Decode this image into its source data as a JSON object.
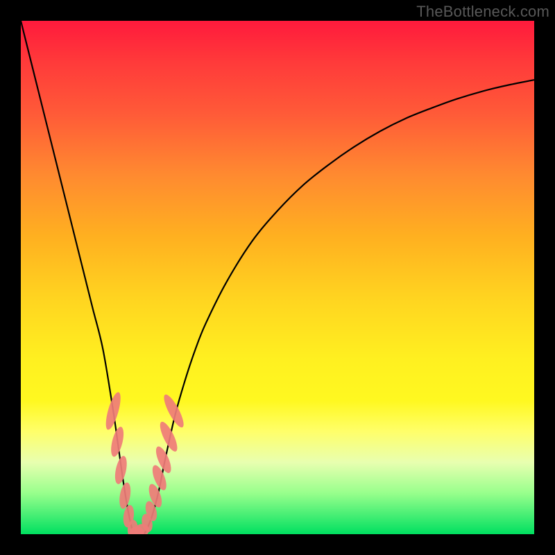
{
  "watermark": "TheBottleneck.com",
  "colors": {
    "frame": "#000000",
    "curve": "#000000",
    "marker_fill": "#ef7c78",
    "marker_stroke": "#ef7c78"
  },
  "chart_data": {
    "type": "line",
    "title": "",
    "xlabel": "",
    "ylabel": "",
    "xlim": [
      0,
      100
    ],
    "ylim": [
      0,
      100
    ],
    "grid": false,
    "series": [
      {
        "name": "bottleneck-curve",
        "x": [
          0,
          2,
          4,
          6,
          8,
          10,
          12,
          14,
          16,
          18,
          19,
          20,
          21,
          22,
          23,
          24,
          25,
          26,
          27,
          28,
          30,
          32,
          34,
          36,
          40,
          45,
          50,
          55,
          60,
          65,
          70,
          75,
          80,
          85,
          90,
          95,
          100
        ],
        "y": [
          100,
          92,
          84,
          76,
          68,
          60,
          52,
          44,
          36,
          24,
          17,
          10,
          4,
          0,
          0,
          0,
          2,
          5,
          9,
          14,
          23,
          30,
          36,
          41,
          49,
          57,
          63,
          68,
          72,
          75.5,
          78.5,
          81,
          83,
          84.8,
          86.3,
          87.5,
          88.5
        ]
      }
    ],
    "markers": [
      {
        "x": 18.0,
        "y": 24,
        "rx": 1.0,
        "ry": 3.8,
        "rot": 16
      },
      {
        "x": 18.8,
        "y": 18,
        "rx": 1.0,
        "ry": 3.0,
        "rot": 14
      },
      {
        "x": 19.5,
        "y": 12.5,
        "rx": 1.0,
        "ry": 2.8,
        "rot": 12
      },
      {
        "x": 20.3,
        "y": 7.5,
        "rx": 1.0,
        "ry": 2.6,
        "rot": 10
      },
      {
        "x": 21.0,
        "y": 3.5,
        "rx": 1.0,
        "ry": 2.2,
        "rot": 8
      },
      {
        "x": 21.8,
        "y": 1.0,
        "rx": 1.0,
        "ry": 1.8,
        "rot": 4
      },
      {
        "x": 22.6,
        "y": 0.3,
        "rx": 1.4,
        "ry": 1.2,
        "rot": 0
      },
      {
        "x": 23.6,
        "y": 0.8,
        "rx": 1.4,
        "ry": 1.2,
        "rot": -4
      },
      {
        "x": 24.6,
        "y": 2.2,
        "rx": 1.0,
        "ry": 1.8,
        "rot": -12
      },
      {
        "x": 25.4,
        "y": 4.5,
        "rx": 1.0,
        "ry": 2.0,
        "rot": -16
      },
      {
        "x": 26.2,
        "y": 7.5,
        "rx": 1.0,
        "ry": 2.4,
        "rot": -20
      },
      {
        "x": 27.0,
        "y": 11.0,
        "rx": 1.0,
        "ry": 2.6,
        "rot": -22
      },
      {
        "x": 27.8,
        "y": 14.5,
        "rx": 1.0,
        "ry": 2.8,
        "rot": -24
      },
      {
        "x": 28.8,
        "y": 19.0,
        "rx": 1.0,
        "ry": 3.2,
        "rot": -26
      },
      {
        "x": 29.8,
        "y": 24.0,
        "rx": 1.0,
        "ry": 3.6,
        "rot": -28
      }
    ]
  }
}
